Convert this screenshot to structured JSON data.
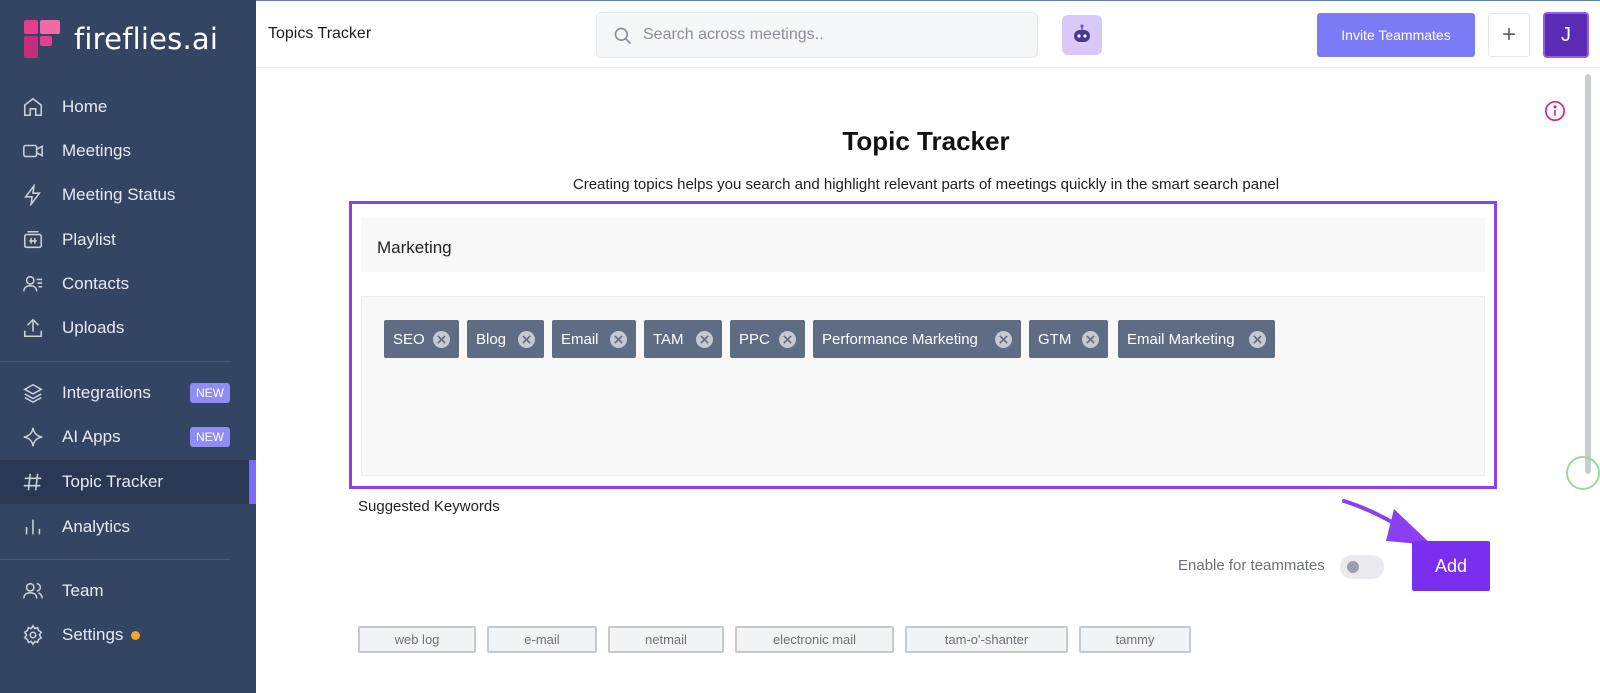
{
  "brand": {
    "name": "fireflies.ai"
  },
  "sidebar": {
    "items": [
      {
        "label": "Home",
        "icon": "home-icon"
      },
      {
        "label": "Meetings",
        "icon": "video-icon"
      },
      {
        "label": "Meeting Status",
        "icon": "bolt-icon"
      },
      {
        "label": "Playlist",
        "icon": "playlist-icon"
      },
      {
        "label": "Contacts",
        "icon": "contacts-icon"
      },
      {
        "label": "Uploads",
        "icon": "upload-icon"
      },
      {
        "label": "Integrations",
        "icon": "layers-icon",
        "badge": "NEW"
      },
      {
        "label": "AI Apps",
        "icon": "sparkle-icon",
        "badge": "NEW"
      },
      {
        "label": "Topic Tracker",
        "icon": "hash-icon",
        "active": true
      },
      {
        "label": "Analytics",
        "icon": "bar-chart-icon"
      },
      {
        "label": "Team",
        "icon": "team-icon"
      },
      {
        "label": "Settings",
        "icon": "gear-icon",
        "status_dot": "#f5a623"
      }
    ]
  },
  "header": {
    "title": "Topics Tracker",
    "search_placeholder": "Search across meetings..",
    "invite_label": "Invite Teammates",
    "plus_label": "+",
    "avatar_initial": "J"
  },
  "main": {
    "title": "Topic Tracker",
    "subtitle": "Creating topics helps you search and highlight relevant parts of meetings quickly in the smart search panel",
    "topic_name": "Marketing",
    "tags": [
      "SEO",
      "Blog",
      "Email",
      "TAM",
      "PPC",
      "Performance Marketing",
      "GTM",
      "Email Marketing"
    ],
    "suggested_label": "Suggested Keywords",
    "toggle_label": "Enable for teammates",
    "toggle_on": false,
    "add_label": "Add",
    "suggested_keywords": [
      "web log",
      "e-mail",
      "netmail",
      "electronic mail",
      "tam-o'-shanter",
      "tammy"
    ]
  },
  "colors": {
    "sidebar_bg": "#344563",
    "accent_purple": "#8a3ff0",
    "invite_button": "#7b7bf5",
    "tag_bg": "#5e6c84",
    "new_badge": "#8f8cf5"
  }
}
